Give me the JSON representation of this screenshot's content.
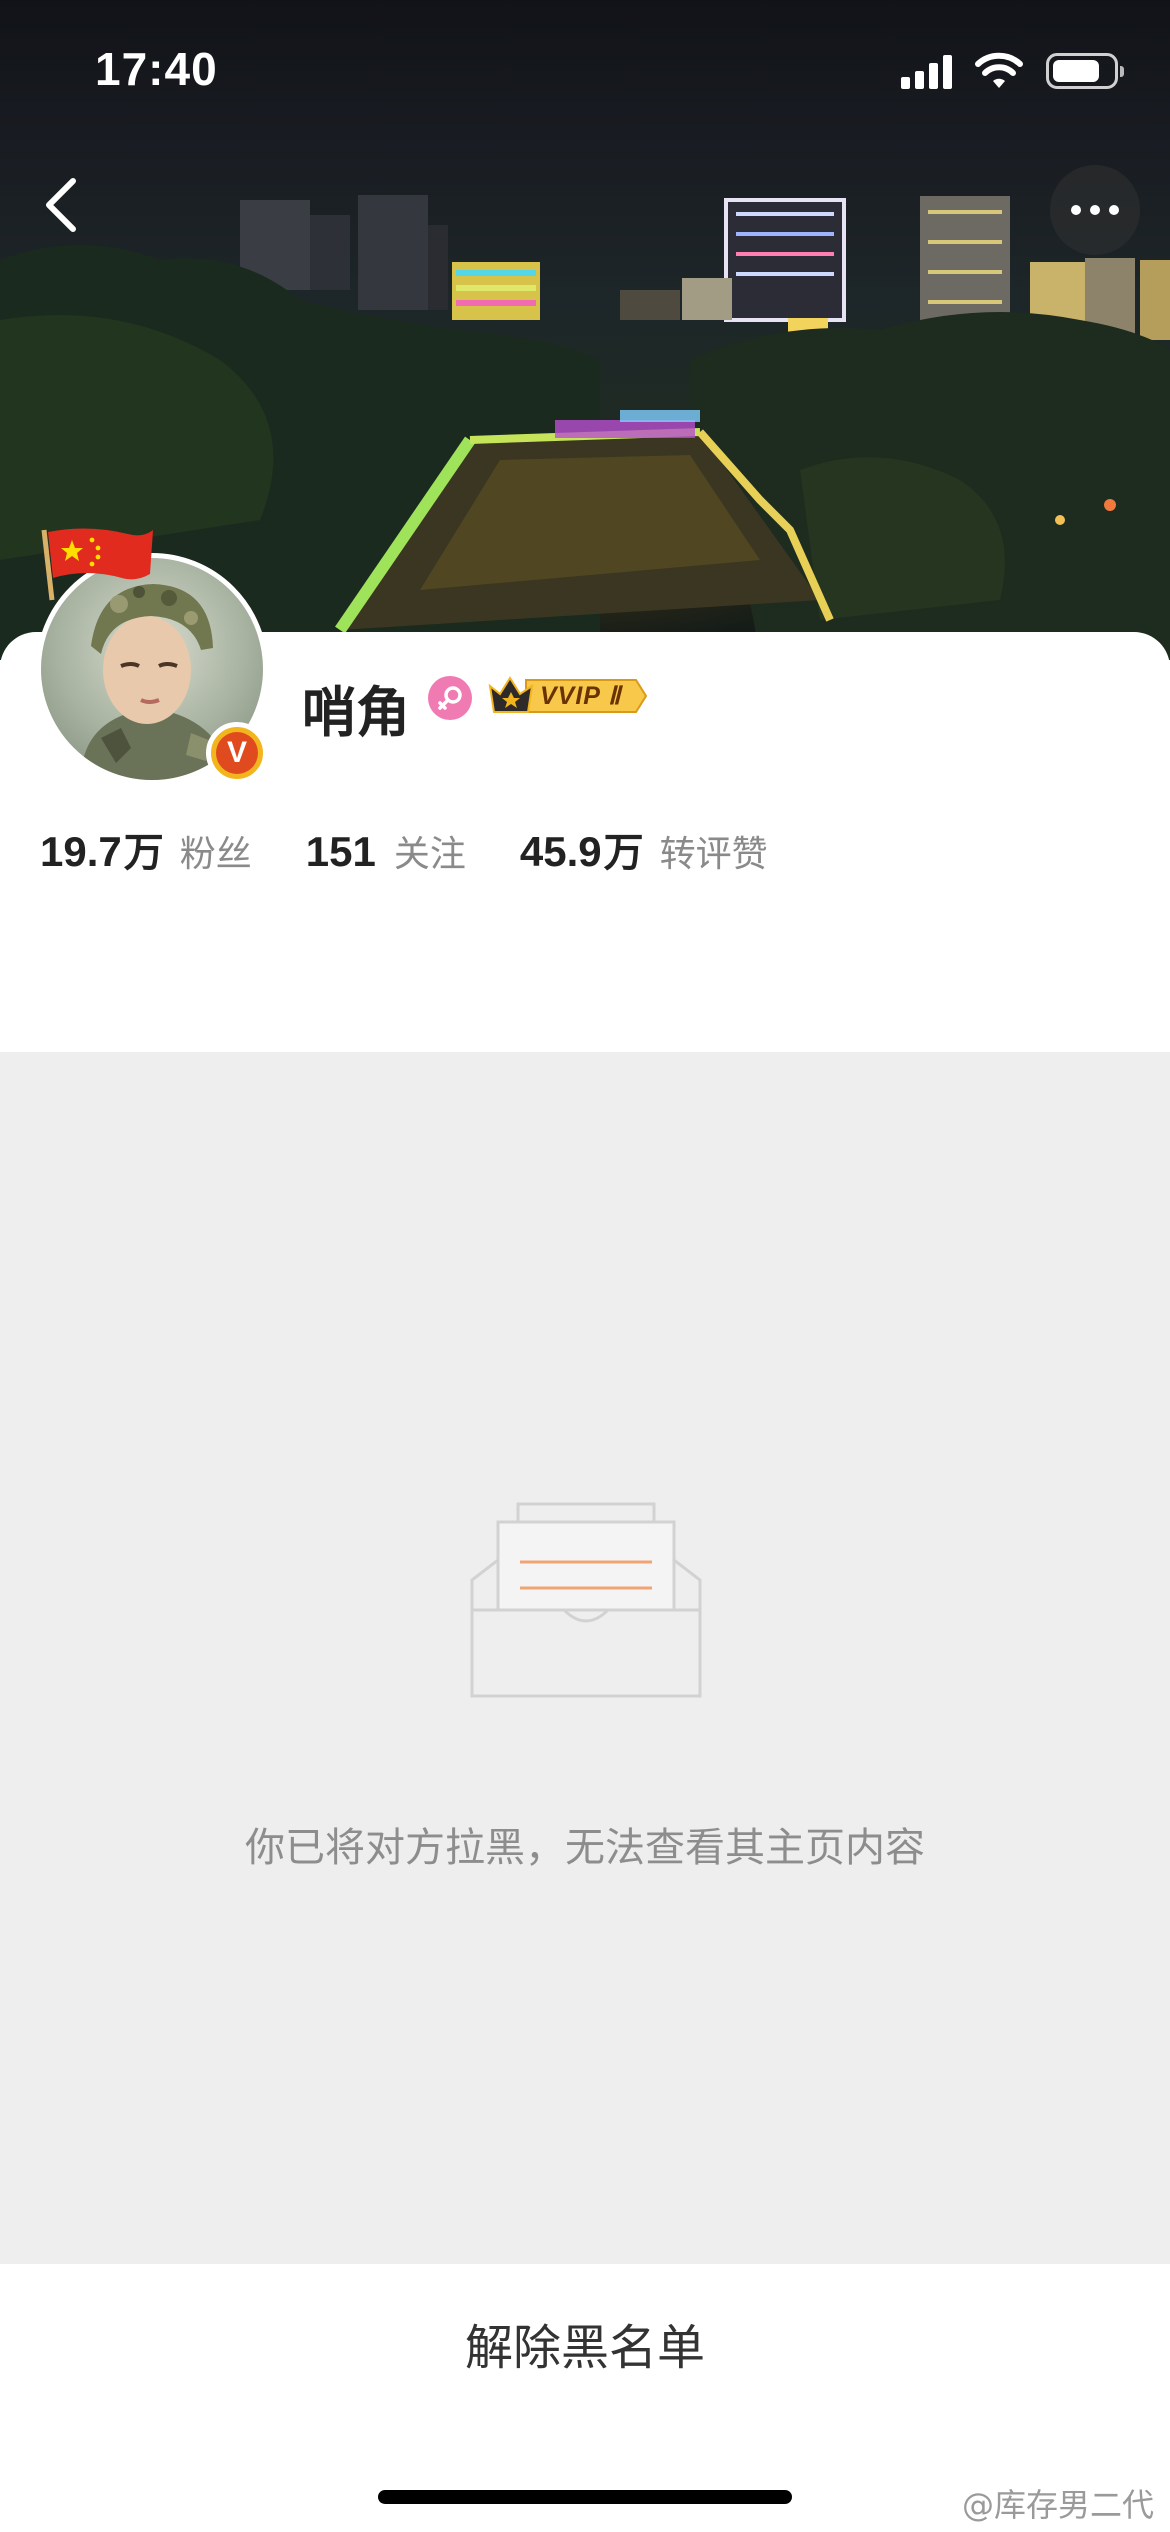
{
  "status_bar": {
    "time": "17:40"
  },
  "profile": {
    "name": "哨角",
    "vip_label": "VVIP Ⅱ",
    "verified_mark": "V"
  },
  "stats": [
    {
      "value": "19.7",
      "unit": "万",
      "label": "粉丝"
    },
    {
      "value": "151",
      "unit": "",
      "label": "关注"
    },
    {
      "value": "45.9",
      "unit": "万",
      "label": "转评赞"
    }
  ],
  "blocked": {
    "message": "你已将对方拉黑，无法查看其主页内容"
  },
  "bottom": {
    "unblock_label": "解除黑名单"
  },
  "watermark": "@库存男二代",
  "icons": {
    "back": "chevron-left-icon",
    "more": "more-dots-icon",
    "gender": "female-icon",
    "empty": "empty-inbox-icon"
  },
  "colors": {
    "content_bg": "#eeeeee",
    "vip_gold": "#f3b51d",
    "gender_pink": "#f07bb3",
    "verified_red": "#e04a1f"
  }
}
